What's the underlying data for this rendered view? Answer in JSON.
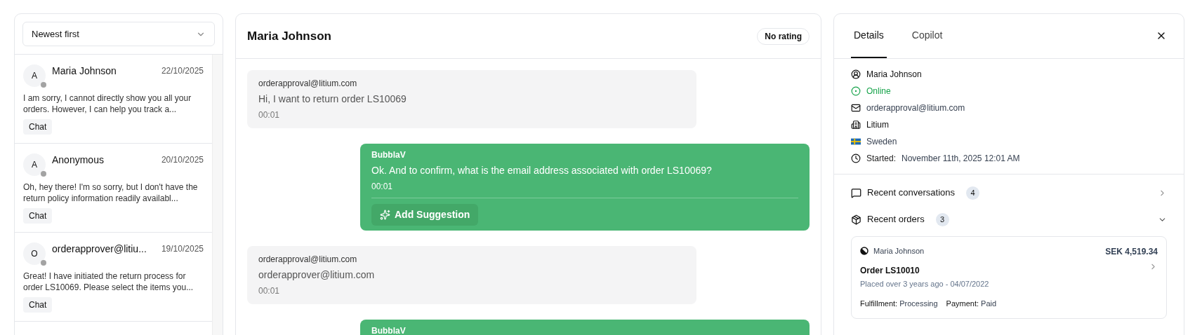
{
  "sort_select": {
    "value": "Newest first"
  },
  "conversations": [
    {
      "initial": "A",
      "name": "Maria Johnson",
      "date": "22/10/2025",
      "online": false,
      "selected": false,
      "preview": "I am sorry, I cannot directly show you all your orders. However, I can help you track a...",
      "tag": "Chat"
    },
    {
      "initial": "A",
      "name": "Anonymous",
      "date": "20/10/2025",
      "online": false,
      "selected": false,
      "preview": "Oh, hey there! I'm so sorry, but I don't have the return policy information readily availabl...",
      "tag": "Chat"
    },
    {
      "initial": "O",
      "name": "orderapprover@litiu...",
      "date": "19/10/2025",
      "online": false,
      "selected": false,
      "preview": "Great! I have initiated the return process for order LS10069. Please select the items you...",
      "tag": "Chat"
    }
  ],
  "chat": {
    "title": "Maria Johnson",
    "rating": "No rating",
    "messages": [
      {
        "kind": "customer",
        "sender": "orderapproval@litium.com",
        "text": "Hi, I want to return order LS10069",
        "time": "00:01"
      },
      {
        "kind": "agent",
        "sender": "BubblaV",
        "text": "Ok. And to confirm, what is the email address associated with order LS10069?",
        "time": "00:01",
        "action": "Add Suggestion"
      },
      {
        "kind": "customer",
        "sender": "orderapproval@litium.com",
        "text": "orderapprover@litium.com",
        "time": "00:01"
      },
      {
        "kind": "agent",
        "sender": "BubblaV"
      }
    ]
  },
  "details": {
    "tabs": [
      {
        "label": "Details",
        "selected": true
      },
      {
        "label": "Copilot",
        "selected": false
      }
    ],
    "rows": [
      {
        "kind": "person",
        "value": "Maria Johnson"
      },
      {
        "kind": "status",
        "value": "Online"
      },
      {
        "kind": "email",
        "value": "orderapproval@litium.com"
      },
      {
        "kind": "company",
        "value": "Litium"
      },
      {
        "kind": "country",
        "value": "Sweden"
      },
      {
        "kind": "started",
        "label": "Started:",
        "value": "November 11th, 2025 12:01 AM"
      }
    ],
    "sections": [
      {
        "kind": "conversations",
        "label": "Recent conversations",
        "count": "4",
        "expanded": false
      },
      {
        "kind": "orders",
        "label": "Recent orders",
        "count": "3",
        "expanded": true
      }
    ],
    "orders": [
      {
        "customer": "Maria Johnson",
        "total": "SEK 4,519.34",
        "title": "Order LS10010",
        "placed": "Placed over 3 years ago - 04/07/2022",
        "fulfillment_label": "Fulfillment:",
        "fulfillment": "Processing",
        "payment_label": "Payment:",
        "payment": "Paid"
      }
    ]
  }
}
